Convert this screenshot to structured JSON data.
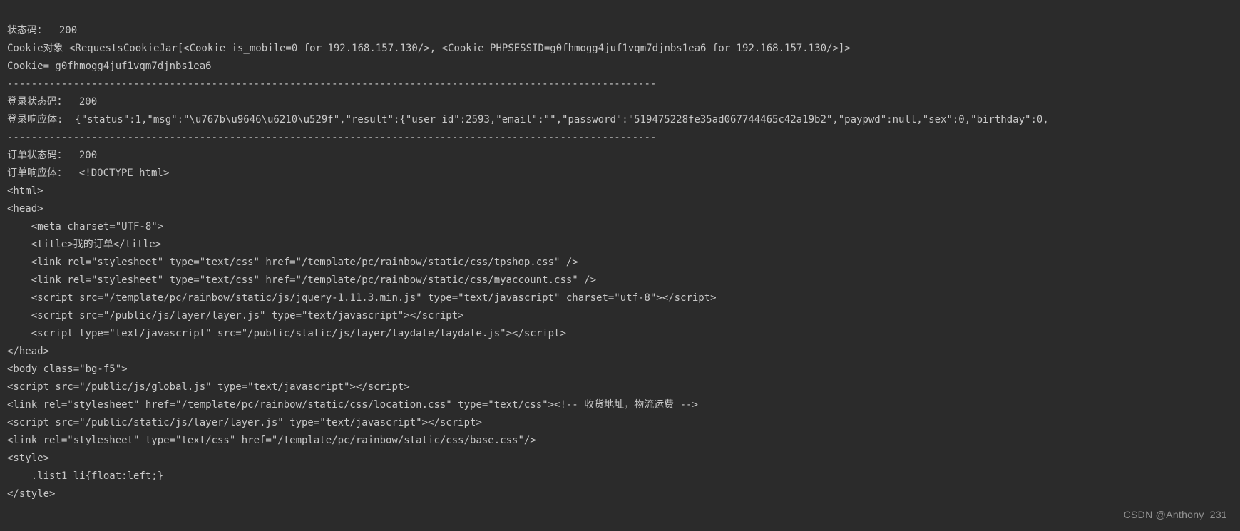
{
  "lines": {
    "l01": "状态码：  200",
    "l02": "Cookie对象 <RequestsCookieJar[<Cookie is_mobile=0 for 192.168.157.130/>, <Cookie PHPSESSID=g0fhmogg4juf1vqm7djnbs1ea6 for 192.168.157.130/>]>",
    "l03": "Cookie= g0fhmogg4juf1vqm7djnbs1ea6",
    "l04": "------------------------------------------------------------------------------------------------------------",
    "l05": "登录状态码：  200",
    "l06": "登录响应体:  {\"status\":1,\"msg\":\"\\u767b\\u9646\\u6210\\u529f\",\"result\":{\"user_id\":2593,\"email\":\"\",\"password\":\"519475228fe35ad067744465c42a19b2\",\"paypwd\":null,\"sex\":0,\"birthday\":0,",
    "l07": "------------------------------------------------------------------------------------------------------------",
    "l08": "订单状态码：  200",
    "l09": "订单响应体：  <!DOCTYPE html>",
    "l10": "<html>",
    "l11": "<head>",
    "l12": "    <meta charset=\"UTF-8\">",
    "l13": "    <title>我的订单</title>",
    "l14": "    <link rel=\"stylesheet\" type=\"text/css\" href=\"/template/pc/rainbow/static/css/tpshop.css\" />",
    "l15": "    <link rel=\"stylesheet\" type=\"text/css\" href=\"/template/pc/rainbow/static/css/myaccount.css\" />",
    "l16": "    <script src=\"/template/pc/rainbow/static/js/jquery-1.11.3.min.js\" type=\"text/javascript\" charset=\"utf-8\"></script>",
    "l17": "    <script src=\"/public/js/layer/layer.js\" type=\"text/javascript\"></script>",
    "l18": "    <script type=\"text/javascript\" src=\"/public/static/js/layer/laydate/laydate.js\"></script>",
    "l19": "</head>",
    "l20": "<body class=\"bg-f5\">",
    "l21": "<script src=\"/public/js/global.js\" type=\"text/javascript\"></script>",
    "l22": "<link rel=\"stylesheet\" href=\"/template/pc/rainbow/static/css/location.css\" type=\"text/css\"><!-- 收货地址，物流运费 -->",
    "l23": "<script src=\"/public/static/js/layer/layer.js\" type=\"text/javascript\"></script>",
    "l24": "<link rel=\"stylesheet\" type=\"text/css\" href=\"/template/pc/rainbow/static/css/base.css\"/>",
    "l25": "<style>",
    "l26": "    .list1 li{float:left;}",
    "l27": "</style>"
  },
  "watermark": "CSDN @Anthony_231"
}
